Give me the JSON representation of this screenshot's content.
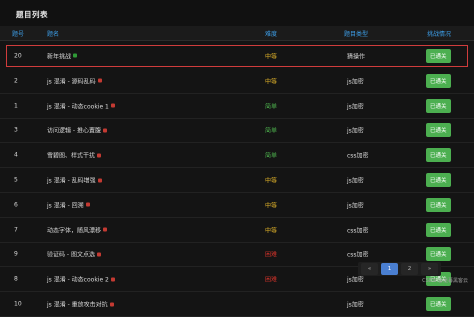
{
  "header": {
    "title": "题目列表"
  },
  "columns": [
    "题号",
    "题名",
    "难度",
    "题目类型",
    "挑战情况"
  ],
  "rows": [
    {
      "num": "20",
      "title": "新年挑战",
      "tag_color": "#2e9a36",
      "difficulty": "中等",
      "difficulty_color": "#e4b52a",
      "type": "猜操作",
      "status": "已通关"
    },
    {
      "num": "2",
      "title": "js 混淆 - 源码乱码",
      "tag_color": "#c43a32",
      "difficulty": "中等",
      "difficulty_color": "#e4b52a",
      "type": "js加密",
      "status": "已通关"
    },
    {
      "num": "1",
      "title": "js 混淆 - 动态cookie 1",
      "tag_color": "#c43a32",
      "difficulty": "简单",
      "difficulty_color": "#4cae4c",
      "type": "js加密",
      "status": "已通关"
    },
    {
      "num": "3",
      "title": "访问逻辑 - 推心置腹",
      "tag_color": "#c43a32",
      "difficulty": "简单",
      "difficulty_color": "#4cae4c",
      "type": "js加密",
      "status": "已通关"
    },
    {
      "num": "4",
      "title": "雪碧图、样式干扰",
      "tag_color": "#c43a32",
      "difficulty": "简单",
      "difficulty_color": "#4cae4c",
      "type": "css加密",
      "status": "已通关"
    },
    {
      "num": "5",
      "title": "js 混淆 - 乱码增强",
      "tag_color": "#c43a32",
      "difficulty": "中等",
      "difficulty_color": "#e4b52a",
      "type": "js加密",
      "status": "已通关"
    },
    {
      "num": "6",
      "title": "js 混淆 - 回溯",
      "tag_color": "#c43a32",
      "difficulty": "中等",
      "difficulty_color": "#e4b52a",
      "type": "js加密",
      "status": "已通关"
    },
    {
      "num": "7",
      "title": "动态字体，随风漂移",
      "tag_color": "#c43a32",
      "difficulty": "中等",
      "difficulty_color": "#e4b52a",
      "type": "css加密",
      "status": "已通关"
    },
    {
      "num": "9",
      "title": "验证码 - 图文点选",
      "tag_color": "#c43a32",
      "difficulty": "困难",
      "difficulty_color": "#d9342b",
      "type": "css加密",
      "status": "已通关"
    },
    {
      "num": "8",
      "title": "js 混淆 - 动态cookie 2",
      "tag_color": "#c43a32",
      "difficulty": "困难",
      "difficulty_color": "#d9342b",
      "type": "js加密",
      "status": "已通关"
    },
    {
      "num": "10",
      "title": "js 混淆 - 重放攻击对抗",
      "tag_color": "#c43a32",
      "difficulty": "",
      "difficulty_color": "#d9342b",
      "type": "js加密",
      "status": "已通关"
    }
  ],
  "pagination": {
    "prev": "«",
    "pages": [
      "1",
      "2"
    ],
    "current": "1",
    "next": "»"
  },
  "watermark": "CSDN @迷暮黑客云"
}
